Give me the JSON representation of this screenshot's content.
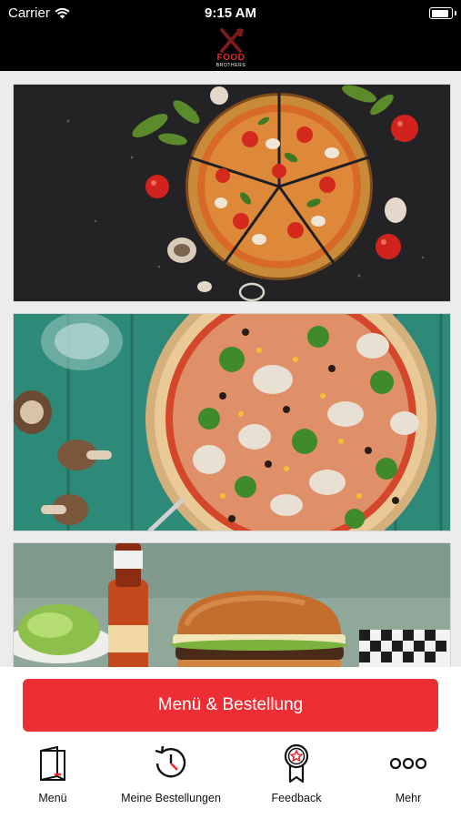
{
  "status_bar": {
    "carrier": "Carrier",
    "time": "9:15 AM",
    "battery_level": 0.9
  },
  "header": {
    "logo": {
      "word": "FOOD",
      "sub": "BROTHERS",
      "icon": "crossed-utensils"
    }
  },
  "feed": [
    {
      "name": "pizza-slices-dark-table"
    },
    {
      "name": "vegetable-pizza-green-table"
    },
    {
      "name": "burger-with-hot-sauce"
    }
  ],
  "cta": {
    "label": "Menü & Bestellung",
    "color": "#ee2e35"
  },
  "tabs": [
    {
      "label": "Menü",
      "icon": "menu-book-icon"
    },
    {
      "label": "Meine Bestellungen",
      "icon": "history-clock-icon"
    },
    {
      "label": "Feedback",
      "icon": "award-ribbon-icon"
    },
    {
      "label": "Mehr",
      "icon": "more-dots-icon"
    }
  ]
}
